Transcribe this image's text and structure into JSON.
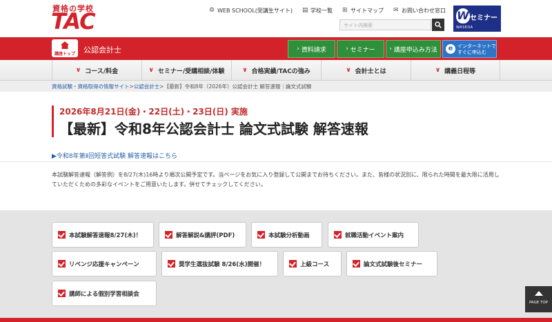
{
  "header": {
    "logo_sub": "資格の学校",
    "logo_main": "TAC",
    "links": [
      {
        "icon": "gear-icon",
        "glyph": "⚙",
        "label": "WEB SCHOOL(受講生サイト)"
      },
      {
        "icon": "book-icon",
        "glyph": "▤",
        "label": "学校一覧"
      },
      {
        "icon": "sitemap-icon",
        "glyph": "⊞",
        "label": "サイトマップ"
      },
      {
        "icon": "mail-icon",
        "glyph": "✉",
        "label": "お問い合わせ窓口"
      }
    ],
    "search_placeholder": "サイト内検索",
    "w_banner": {
      "letter": "W",
      "text": "セミナー",
      "small": "WASEDA"
    }
  },
  "redbar": {
    "home_label": "講座トップ",
    "section": "公認会計士",
    "buttons": [
      "資料請求",
      "セミナー",
      "講座申込み方法"
    ],
    "blue_line1": "インターネットで",
    "blue_line2": "すぐに申込む"
  },
  "nav": [
    "コース/料金",
    "セミナー/受講相談/体験",
    "合格実績/TACの強み",
    "会計士とは",
    "講義日程等"
  ],
  "breadcrumb": {
    "link1": "資格試験・資格取得の情報サイト",
    "link2": "公認会計士",
    "current": "【最新】令和8年（2026年）公認会計士 解答速報｜論文式試験"
  },
  "title": {
    "date": "2026年8月21日(金)・22日(土)・23日(日) 実施",
    "main": "【最新】令和8年公認会計士 論文式試験 解答速報",
    "sub_link": "▶令和8年第Ⅱ回短答式試験 解答速報はこちら"
  },
  "description": "本試験解答速報（解答例）を8/27(木)16時より順次公開予定です。当ページをお気に入り登録して公開までお待ちください。また、皆様の状況別に、限られた時間を最大限に活用していただくための多彩なイベントをご用意いたします。併せてチェックしてください。",
  "buttons": [
    "本試験解答速報8/27(木)！",
    "解答解説&講評(PDF)",
    "本試験分析動画",
    "就職活動イベント案内",
    "リベンジ応援キャンペーン",
    "奨学生選抜試験 8/26(水)開催！",
    "上級コース",
    "論文式試験後セミナー",
    "講師による個別学習相談会"
  ],
  "pagetop": "PAGE TOP",
  "colors": {
    "brand_red": "#d3222a",
    "green": "#2f8f3a",
    "blue": "#2d74c7",
    "link": "#2560a8"
  }
}
